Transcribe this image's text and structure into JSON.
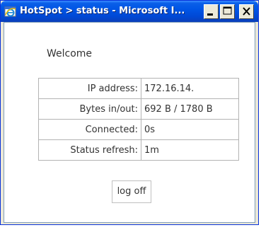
{
  "window": {
    "title": "HotSpot > status - Microsoft I...",
    "controls": {
      "minimize_icon": "minimize-icon",
      "maximize_icon": "maximize-icon",
      "close_icon": "close-icon"
    },
    "app_icon": "internet-explorer-icon"
  },
  "page": {
    "welcome": "Welcome",
    "rows": [
      {
        "label": "IP address:",
        "value": "172.16.14."
      },
      {
        "label": "Bytes in/out:",
        "value": "692 B / 1780 B"
      },
      {
        "label": "Connected:",
        "value": "0s"
      },
      {
        "label": "Status refresh:",
        "value": "1m"
      }
    ],
    "logoff_label": "log off"
  },
  "colors": {
    "titlebar": "#0055e5",
    "window_frame": "#ece9d8",
    "text": "#333333",
    "table_border": "#b3b3b3"
  }
}
